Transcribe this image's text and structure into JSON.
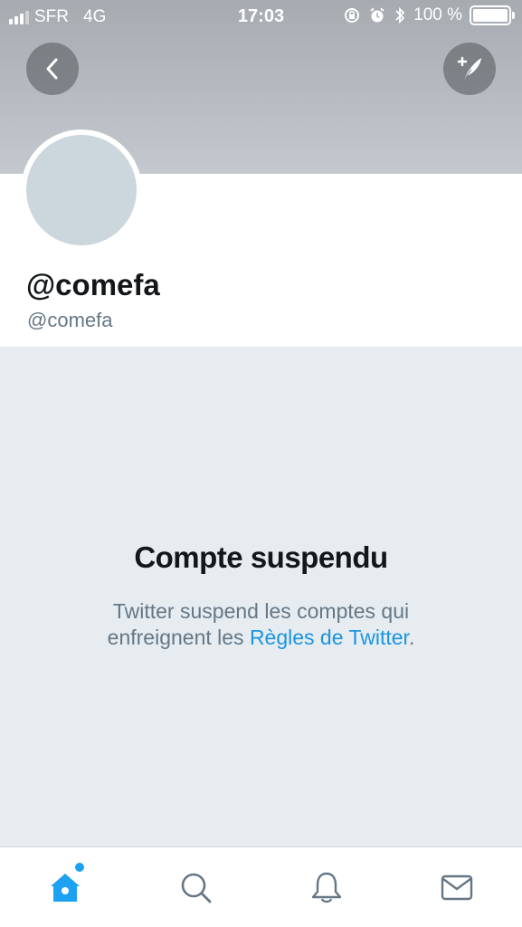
{
  "status_bar": {
    "carrier": "SFR",
    "network": "4G",
    "time": "17:03",
    "battery": "100 %"
  },
  "profile": {
    "display_name": "@comefa",
    "handle": "@comefa"
  },
  "suspended": {
    "title": "Compte suspendu",
    "text_line1": "Twitter suspend les comptes qui",
    "text_line2_prefix": "enfreignent les ",
    "rules_link": "Règles de Twitter",
    "text_line2_suffix": "."
  },
  "tab_bar": {
    "active": "home",
    "home_notification_dot": true
  },
  "colors": {
    "accent": "#1da1f2",
    "link": "#1b95e0",
    "background": "#e6ecf0"
  }
}
